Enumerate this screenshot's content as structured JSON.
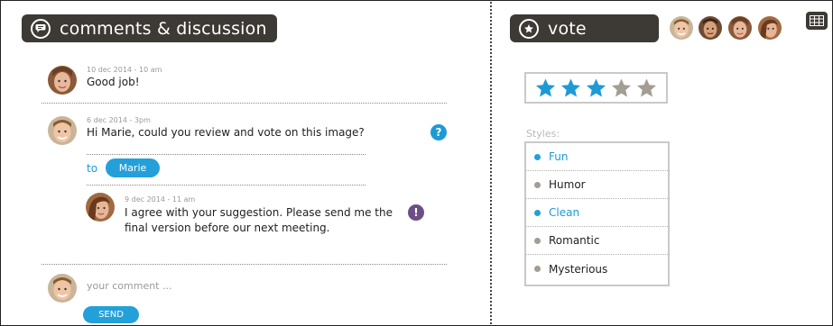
{
  "comments_header": {
    "title": "comments & discussion"
  },
  "comments": [
    {
      "timestamp": "10 dec 2014 - 10 am",
      "text": "Good job!"
    },
    {
      "timestamp": "6 dec 2014 - 3pm",
      "text": "Hi Marie, could you review and vote on this image?",
      "badge": "?"
    }
  ],
  "reply_to": {
    "label": "to",
    "recipient": "Marie"
  },
  "reply": {
    "timestamp": "9 dec 2014 - 11 am",
    "line1": "I agree with your suggestion. Please send me the",
    "line2": "final version before our next meeting.",
    "badge": "!"
  },
  "composer": {
    "placeholder": "your comment ...",
    "send_label": "SEND"
  },
  "vote": {
    "title": "vote",
    "rating": 3,
    "max_rating": 5
  },
  "styles": {
    "label": "Styles:",
    "items": [
      {
        "label": "Fun",
        "selected": true
      },
      {
        "label": "Humor",
        "selected": false
      },
      {
        "label": "Clean",
        "selected": true
      },
      {
        "label": "Romantic",
        "selected": false
      },
      {
        "label": "Mysterious",
        "selected": false
      }
    ]
  },
  "colors": {
    "header_bg": "#3d3935",
    "accent": "#23a0da",
    "star_on": "#1d9ad6",
    "star_off": "#a39d93",
    "alert": "#6b4f86",
    "muted_dot": "#a39d93"
  },
  "icons": {
    "comments_header": "speech-bubble-icon",
    "vote_header": "star-circle-icon",
    "grid": "grid-icon"
  }
}
